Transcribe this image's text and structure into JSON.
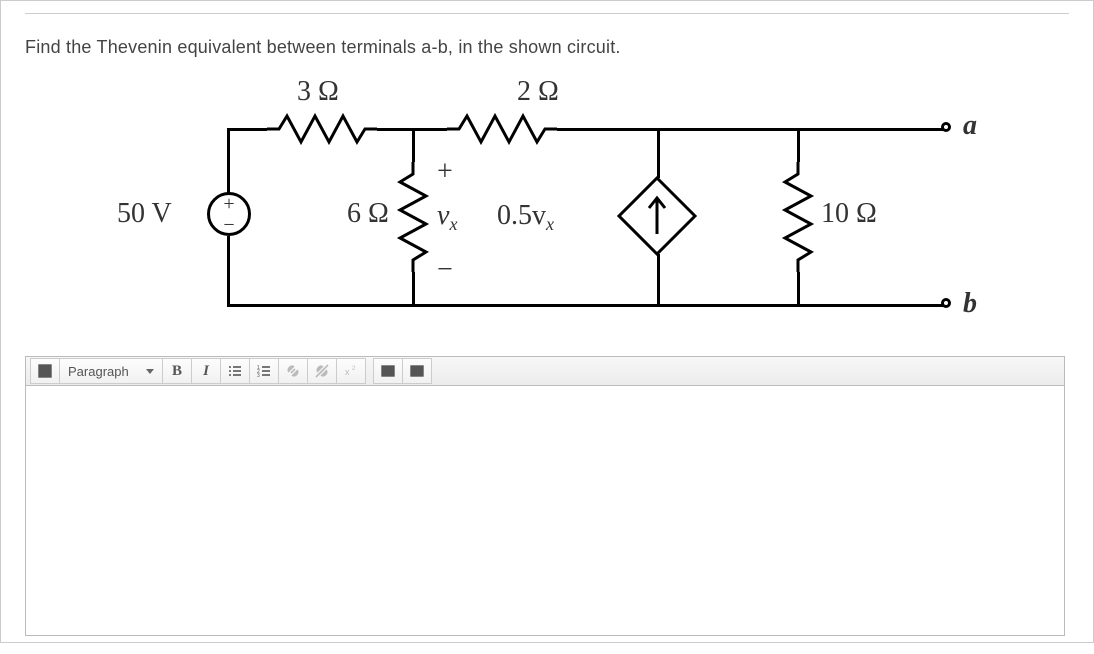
{
  "question": "Find the Thevenin equivalent between terminals a-b, in the shown circuit.",
  "circuit": {
    "source_label": "50 V",
    "r1": "3 Ω",
    "r2": "6 Ω",
    "r3": "2 Ω",
    "r4": "10 Ω",
    "vx": "v",
    "vx_sub": "x",
    "vx_plus": "+",
    "vx_minus": "−",
    "dep_src": "0.5v",
    "dep_src_sub": "x",
    "term_a": "a",
    "term_b": "b",
    "src_plus": "+",
    "src_minus": "−"
  },
  "toolbar": {
    "format": "Paragraph",
    "bold": "B",
    "italic": "I"
  }
}
